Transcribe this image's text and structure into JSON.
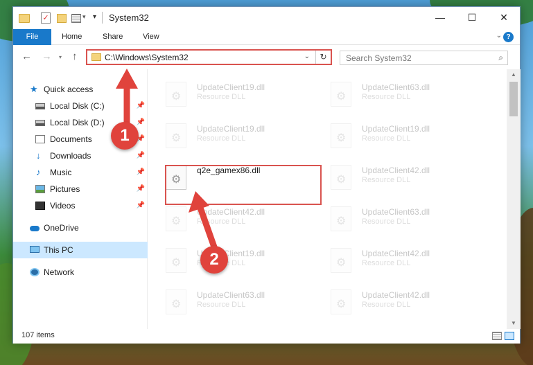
{
  "window": {
    "title": "System32",
    "controls": {
      "minimize": "—",
      "maximize": "☐",
      "close": "✕"
    }
  },
  "ribbon": {
    "tabs": {
      "file": "File",
      "home": "Home",
      "share": "Share",
      "view": "View"
    },
    "help": "?"
  },
  "navbar": {
    "address": "C:\\Windows\\System32",
    "search_placeholder": "Search System32"
  },
  "sidebar": {
    "items": [
      {
        "label": "Quick access",
        "icon": "star-icon",
        "pinned": false
      },
      {
        "label": "Local Disk (C:)",
        "icon": "drive-icon",
        "pinned": true
      },
      {
        "label": "Local Disk (D:)",
        "icon": "drive-icon",
        "pinned": true
      },
      {
        "label": "Documents",
        "icon": "documents-icon",
        "pinned": true
      },
      {
        "label": "Downloads",
        "icon": "download-icon",
        "pinned": true
      },
      {
        "label": "Music",
        "icon": "music-icon",
        "pinned": true
      },
      {
        "label": "Pictures",
        "icon": "pictures-icon",
        "pinned": true
      },
      {
        "label": "Videos",
        "icon": "videos-icon",
        "pinned": true
      },
      {
        "label": "OneDrive",
        "icon": "cloud-icon",
        "pinned": false
      },
      {
        "label": "This PC",
        "icon": "pc-icon",
        "pinned": false,
        "selected": true
      },
      {
        "label": "Network",
        "icon": "network-icon",
        "pinned": false
      }
    ]
  },
  "files": [
    {
      "name": "UpdateClient19.dll",
      "type": "Resource DLL"
    },
    {
      "name": "UpdateClient63.dll",
      "type": "Resource DLL"
    },
    {
      "name": "UpdateClient19.dll",
      "type": "Resource DLL"
    },
    {
      "name": "UpdateClient19.dll",
      "type": "Resource DLL"
    },
    {
      "name": "q2e_gamex86.dll",
      "type": ""
    },
    {
      "name": "UpdateClient42.dll",
      "type": "Resource DLL"
    },
    {
      "name": "UpdateClient42.dll",
      "type": "Resource DLL"
    },
    {
      "name": "UpdateClient63.dll",
      "type": "Resource DLL"
    },
    {
      "name": "UpdateClient19.dll",
      "type": "Resource DLL"
    },
    {
      "name": "UpdateClient42.dll",
      "type": "Resource DLL"
    },
    {
      "name": "UpdateClient63.dll",
      "type": "Resource DLL"
    },
    {
      "name": "UpdateClient42.dll",
      "type": "Resource DLL"
    }
  ],
  "status": {
    "item_count": "107 items"
  },
  "annotations": {
    "step1": "1",
    "step2": "2",
    "color": "#e0433c"
  }
}
